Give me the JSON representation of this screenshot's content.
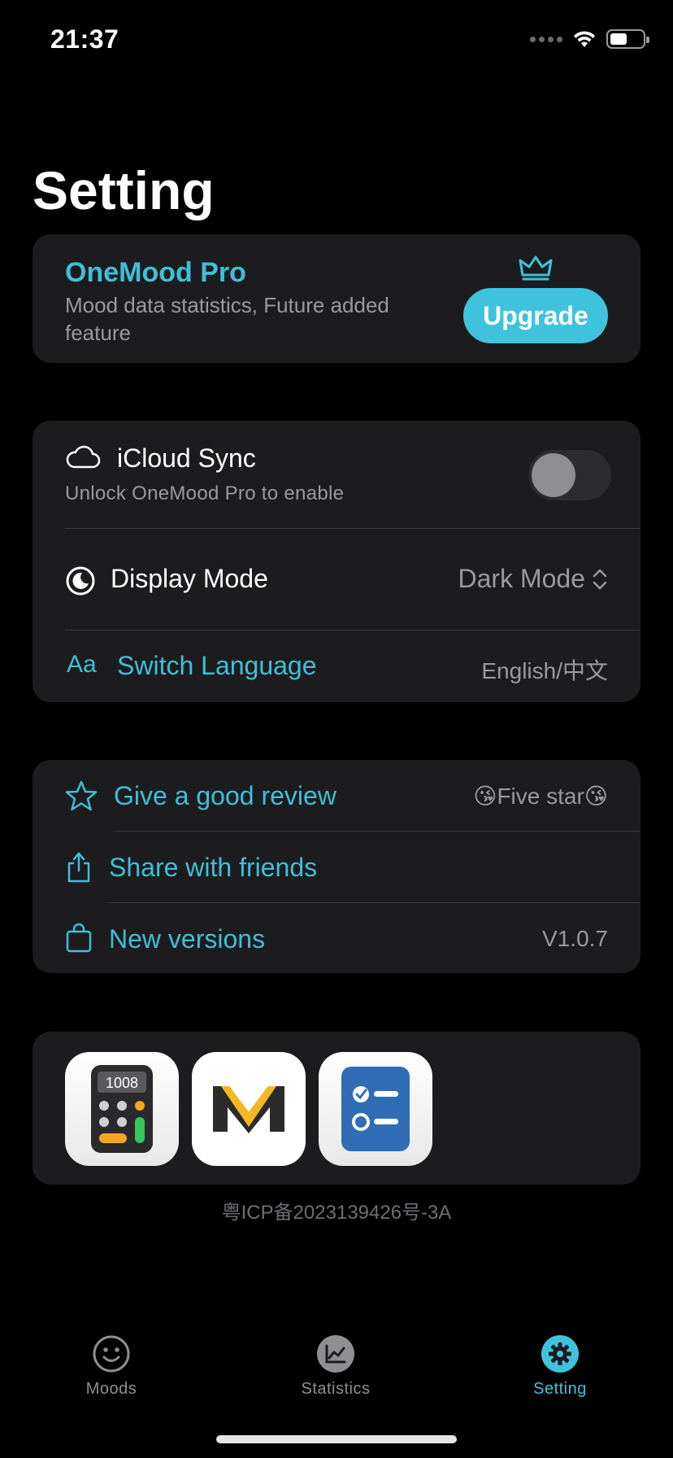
{
  "status_bar": {
    "time": "21:37"
  },
  "page": {
    "title": "Setting"
  },
  "pro_card": {
    "title": "OneMood Pro",
    "description": "Mood data statistics, Future added feature",
    "upgrade_label": "Upgrade"
  },
  "settings": {
    "icloud": {
      "label": "iCloud Sync",
      "subtitle": "Unlock OneMood Pro to enable",
      "enabled": false
    },
    "display_mode": {
      "label": "Display Mode",
      "value": "Dark Mode"
    },
    "language": {
      "icon_text": "Aa",
      "label": "Switch Language",
      "value": "English/中文"
    }
  },
  "feedback": {
    "review": {
      "label": "Give a good review",
      "value": "😘Five star😘"
    },
    "share": {
      "label": "Share with friends"
    },
    "versions": {
      "label": "New versions",
      "value": "V1.0.7"
    }
  },
  "apps": [
    {
      "icon": "calculator-app-icon",
      "display_text": "1008"
    },
    {
      "icon": "m-letter-app-icon"
    },
    {
      "icon": "checklist-app-icon"
    }
  ],
  "footer": {
    "icp": "粤ICP备2023139426号-3A"
  },
  "tabs": [
    {
      "label": "Moods",
      "icon": "smiley-icon",
      "active": false
    },
    {
      "label": "Statistics",
      "icon": "chart-icon",
      "active": false
    },
    {
      "label": "Setting",
      "icon": "gear-icon",
      "active": true
    }
  ],
  "colors": {
    "accent": "#3fc3dc",
    "card": "#1c1c1e",
    "background": "#000000",
    "secondary_text": "#9a9a9e"
  }
}
